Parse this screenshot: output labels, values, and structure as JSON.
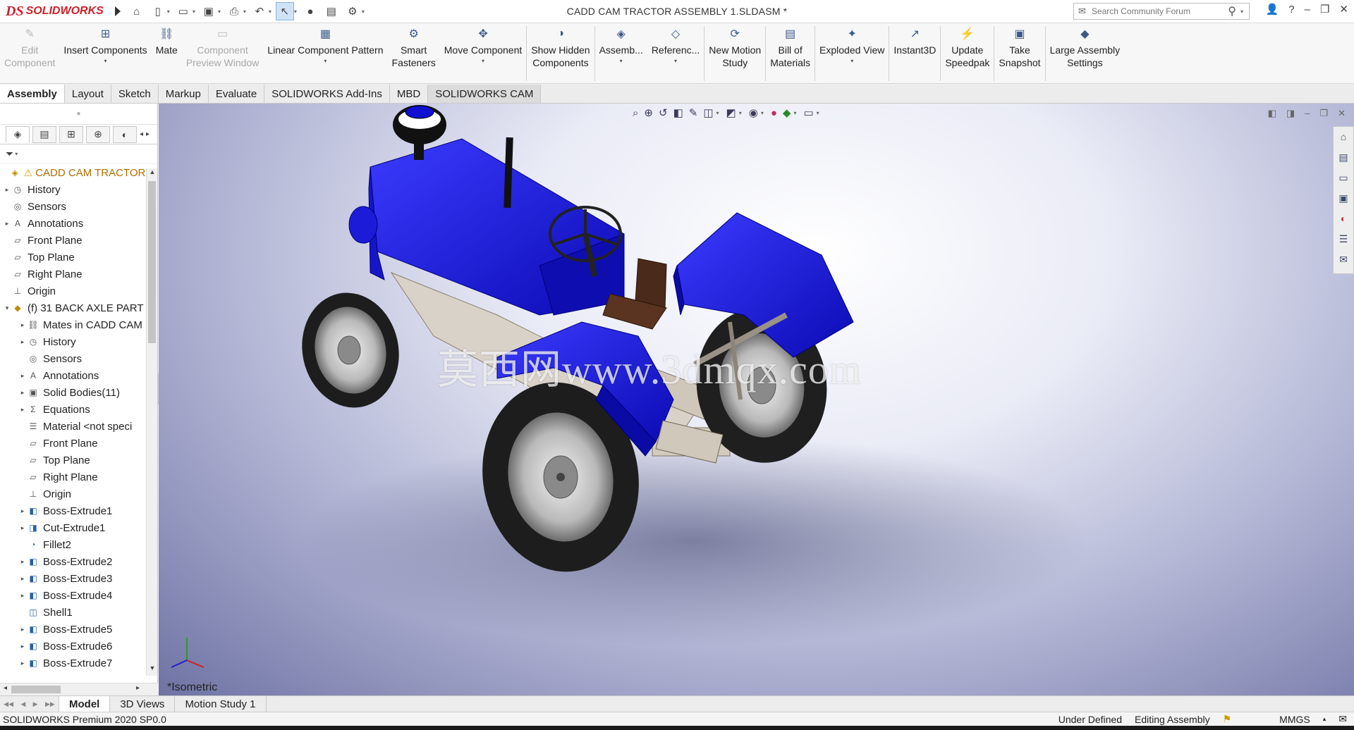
{
  "app": {
    "logo_text": "SOLIDWORKS",
    "document_title": "CADD CAM TRACTOR ASSEMBLY 1.SLDASM *"
  },
  "search": {
    "placeholder": "Search Community Forum"
  },
  "commands": [
    {
      "label": "Edit\nComponent",
      "icon": "edit-component-icon",
      "disabled": true,
      "has_dropdown": false
    },
    {
      "label": "Insert Components",
      "icon": "insert-components-icon",
      "disabled": false,
      "has_dropdown": true
    },
    {
      "label": "Mate",
      "icon": "mate-icon",
      "disabled": false,
      "has_dropdown": false
    },
    {
      "label": "Component\nPreview Window",
      "icon": "component-preview-icon",
      "disabled": true,
      "has_dropdown": false
    },
    {
      "label": "Linear Component Pattern",
      "icon": "linear-pattern-icon",
      "disabled": false,
      "has_dropdown": true
    },
    {
      "label": "Smart\nFasteners",
      "icon": "smart-fasteners-icon",
      "disabled": false,
      "has_dropdown": false
    },
    {
      "label": "Move Component",
      "icon": "move-component-icon",
      "disabled": false,
      "has_dropdown": true
    },
    {
      "label": "Show Hidden\nComponents",
      "icon": "show-hidden-icon",
      "disabled": false,
      "has_dropdown": false
    },
    {
      "label": "Assemb...",
      "icon": "assembly-features-icon",
      "disabled": false,
      "has_dropdown": true
    },
    {
      "label": "Referenc...",
      "icon": "reference-geometry-icon",
      "disabled": false,
      "has_dropdown": true
    },
    {
      "label": "New Motion\nStudy",
      "icon": "motion-study-icon",
      "disabled": false,
      "has_dropdown": false
    },
    {
      "label": "Bill of\nMaterials",
      "icon": "bom-icon",
      "disabled": false,
      "has_dropdown": false
    },
    {
      "label": "Exploded View",
      "icon": "exploded-view-icon",
      "disabled": false,
      "has_dropdown": true
    },
    {
      "label": "Instant3D",
      "icon": "instant3d-icon",
      "disabled": false,
      "has_dropdown": false
    },
    {
      "label": "Update\nSpeedpak",
      "icon": "speedpak-icon",
      "disabled": false,
      "has_dropdown": false
    },
    {
      "label": "Take\nSnapshot",
      "icon": "snapshot-icon",
      "disabled": false,
      "has_dropdown": false
    },
    {
      "label": "Large Assembly\nSettings",
      "icon": "large-assembly-icon",
      "disabled": false,
      "has_dropdown": false
    }
  ],
  "tabs": [
    "Assembly",
    "Layout",
    "Sketch",
    "Markup",
    "Evaluate",
    "SOLIDWORKS Add-Ins",
    "MBD",
    "SOLIDWORKS CAM"
  ],
  "active_tab": "Assembly",
  "tree": [
    {
      "level": 0,
      "expander": "",
      "icon": "assembly-icon",
      "label": "CADD CAM TRACTOR ...",
      "root": true
    },
    {
      "level": 0,
      "expander": "▸",
      "icon": "history-icon",
      "label": "History"
    },
    {
      "level": 0,
      "expander": "",
      "icon": "sensors-icon",
      "label": "Sensors"
    },
    {
      "level": 0,
      "expander": "▸",
      "icon": "annotations-icon",
      "label": "Annotations"
    },
    {
      "level": 0,
      "expander": "",
      "icon": "plane-icon",
      "label": "Front Plane"
    },
    {
      "level": 0,
      "expander": "",
      "icon": "plane-icon",
      "label": "Top Plane"
    },
    {
      "level": 0,
      "expander": "",
      "icon": "plane-icon",
      "label": "Right Plane"
    },
    {
      "level": 0,
      "expander": "",
      "icon": "origin-icon",
      "label": "Origin"
    },
    {
      "level": 0,
      "expander": "▾",
      "icon": "part-icon",
      "label": "(f) 31 BACK AXLE PART"
    },
    {
      "level": 1,
      "expander": "▸",
      "icon": "mates-icon",
      "label": "Mates in CADD CAM"
    },
    {
      "level": 1,
      "expander": "▸",
      "icon": "history-icon",
      "label": "History"
    },
    {
      "level": 1,
      "expander": "",
      "icon": "sensors-icon",
      "label": "Sensors"
    },
    {
      "level": 1,
      "expander": "▸",
      "icon": "annotations-icon",
      "label": "Annotations"
    },
    {
      "level": 1,
      "expander": "▸",
      "icon": "solid-bodies-icon",
      "label": "Solid Bodies(11)"
    },
    {
      "level": 1,
      "expander": "▸",
      "icon": "equations-icon",
      "label": "Equations"
    },
    {
      "level": 1,
      "expander": "",
      "icon": "material-icon",
      "label": "Material <not speci"
    },
    {
      "level": 1,
      "expander": "",
      "icon": "plane-icon",
      "label": "Front Plane"
    },
    {
      "level": 1,
      "expander": "",
      "icon": "plane-icon",
      "label": "Top Plane"
    },
    {
      "level": 1,
      "expander": "",
      "icon": "plane-icon",
      "label": "Right Plane"
    },
    {
      "level": 1,
      "expander": "",
      "icon": "origin-icon",
      "label": "Origin"
    },
    {
      "level": 1,
      "expander": "▸",
      "icon": "boss-extrude-icon",
      "label": "Boss-Extrude1"
    },
    {
      "level": 1,
      "expander": "▸",
      "icon": "cut-extrude-icon",
      "label": "Cut-Extrude1"
    },
    {
      "level": 1,
      "expander": "",
      "icon": "fillet-icon",
      "label": "Fillet2"
    },
    {
      "level": 1,
      "expander": "▸",
      "icon": "boss-extrude-icon",
      "label": "Boss-Extrude2"
    },
    {
      "level": 1,
      "expander": "▸",
      "icon": "boss-extrude-icon",
      "label": "Boss-Extrude3"
    },
    {
      "level": 1,
      "expander": "▸",
      "icon": "boss-extrude-icon",
      "label": "Boss-Extrude4"
    },
    {
      "level": 1,
      "expander": "",
      "icon": "shell-icon",
      "label": "Shell1"
    },
    {
      "level": 1,
      "expander": "▸",
      "icon": "boss-extrude-icon",
      "label": "Boss-Extrude5"
    },
    {
      "level": 1,
      "expander": "▸",
      "icon": "boss-extrude-icon",
      "label": "Boss-Extrude6"
    },
    {
      "level": 1,
      "expander": "▸",
      "icon": "boss-extrude-icon",
      "label": "Boss-Extrude7"
    }
  ],
  "viewport": {
    "view_name": "*Isometric",
    "watermark": "莫西网www.3dmqx.com",
    "model_color": "#1a1ae0"
  },
  "bottom_tabs": [
    "Model",
    "3D Views",
    "Motion Study 1"
  ],
  "active_bottom_tab": "Model",
  "status": {
    "version": "SOLIDWORKS Premium 2020 SP0.0",
    "state": "Under Defined",
    "mode": "Editing Assembly",
    "units": "MMGS"
  },
  "colors": {
    "brand_red": "#d0202a",
    "tractor_blue": "#1a1ae0",
    "root_item": "#b07000"
  }
}
